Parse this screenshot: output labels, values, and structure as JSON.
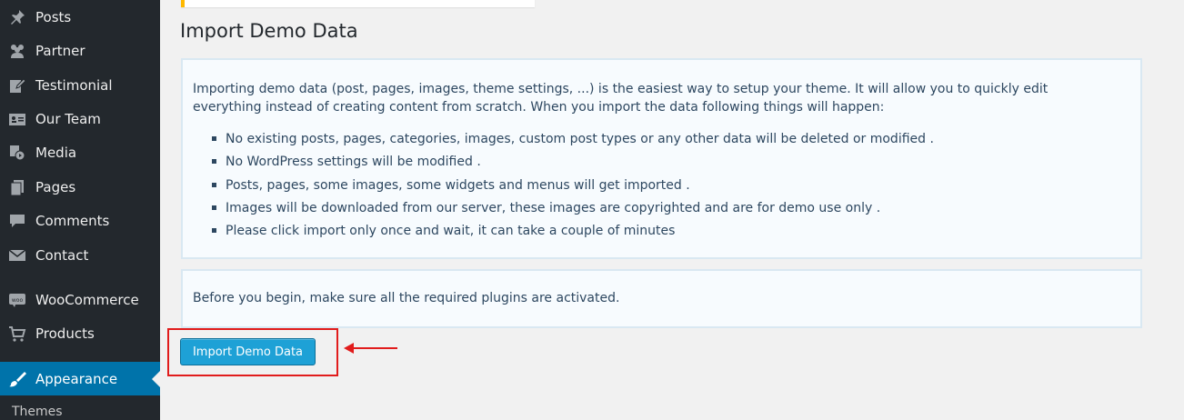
{
  "sidebar": {
    "items": [
      {
        "label": "Posts",
        "icon": "pushpin-icon"
      },
      {
        "label": "Partner",
        "icon": "users-icon"
      },
      {
        "label": "Testimonial",
        "icon": "edit-icon"
      },
      {
        "label": "Our Team",
        "icon": "id-card-icon"
      },
      {
        "label": "Media",
        "icon": "media-icon"
      },
      {
        "label": "Pages",
        "icon": "pages-icon"
      },
      {
        "label": "Comments",
        "icon": "comment-icon"
      },
      {
        "label": "Contact",
        "icon": "mail-icon"
      },
      {
        "label": "WooCommerce",
        "icon": "woocommerce-icon",
        "icon_text": "woo"
      },
      {
        "label": "Products",
        "icon": "cart-icon"
      },
      {
        "label": "Appearance",
        "icon": "paintbrush-icon",
        "active": true
      }
    ],
    "submenu": {
      "label": "Themes"
    }
  },
  "main": {
    "title": "Import Demo Data",
    "intro": "Importing demo data (post, pages, images, theme settings, ...) is the easiest way to setup your theme. It will allow you to quickly edit everything instead of creating content from scratch. When you import the data following things will happen:",
    "bullets": [
      "No existing posts, pages, categories, images, custom post types or any other data will be deleted or modified .",
      "No WordPress settings will be modified .",
      "Posts, pages, some images, some widgets and menus will get imported .",
      "Images will be downloaded from our server, these images are copyrighted and are for demo use only .",
      "Please click import only once and wait, it can take a couple of minutes"
    ],
    "before_begin": "Before you begin, make sure all the required plugins are activated.",
    "import_button_label": "Import Demo Data"
  },
  "colors": {
    "sidebar_bg": "#23282d",
    "active_bg": "#0073aa",
    "button_bg": "#1ea1d6",
    "highlight": "#e11c1c",
    "notice_accent": "#ffb900"
  }
}
